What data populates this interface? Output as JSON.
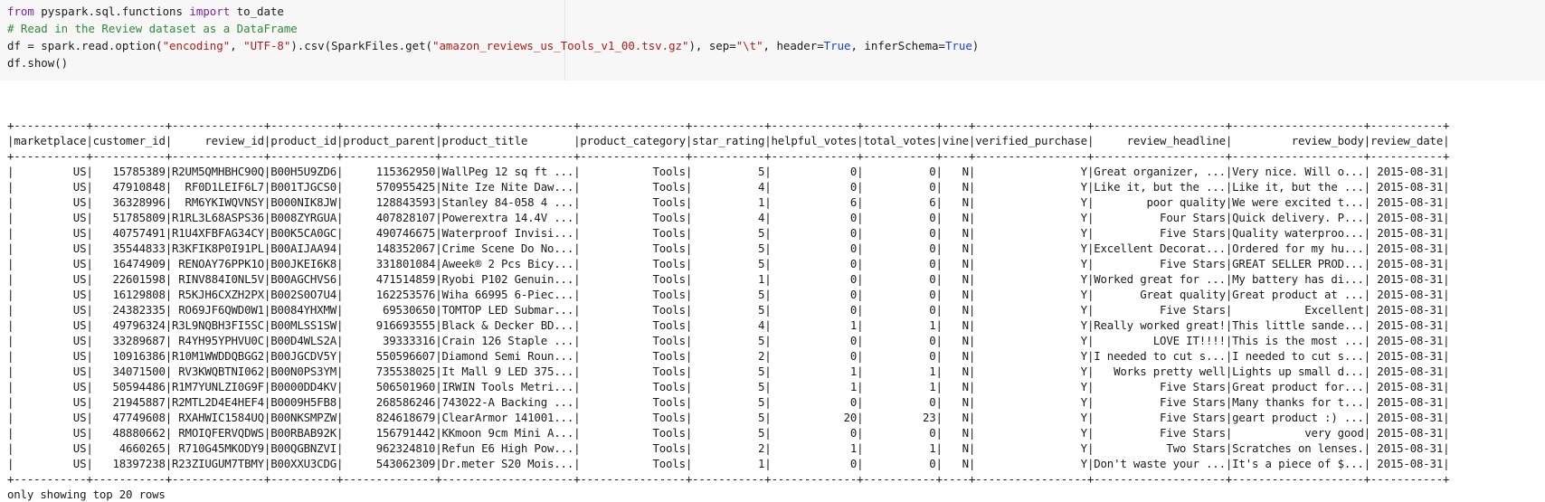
{
  "code_cell": {
    "line1": {
      "kw1": "from",
      "mod": " pyspark.sql.functions ",
      "kw2": "import",
      "rest": " to_date"
    },
    "line2": {
      "comment": "# Read in the Review dataset as a DataFrame"
    },
    "line3": {
      "a": "df = spark.read.option(",
      "s1": "\"encoding\"",
      "b": ", ",
      "s2": "\"UTF-8\"",
      "c": ").csv(SparkFiles.get(",
      "s3": "\"amazon_reviews_us_Tools_v1_00.tsv.gz\"",
      "d": "), sep=",
      "s4": "\"\\t\"",
      "e": ", header=",
      "t1": "True",
      "f": ", inferSchema=",
      "t2": "True",
      "g": ")"
    },
    "line4": {
      "text": "df.show()"
    }
  },
  "output": {
    "columns": [
      {
        "name": "marketplace",
        "width": 11,
        "align": "right"
      },
      {
        "name": "customer_id",
        "width": 11,
        "align": "right"
      },
      {
        "name": "review_id",
        "width": 14,
        "align": "right"
      },
      {
        "name": "product_id",
        "width": 10,
        "align": "right"
      },
      {
        "name": "product_parent",
        "width": 14,
        "align": "right"
      },
      {
        "name": "product_title",
        "width": 20,
        "align": "left"
      },
      {
        "name": "product_category",
        "width": 16,
        "align": "right"
      },
      {
        "name": "star_rating",
        "width": 11,
        "align": "right"
      },
      {
        "name": "helpful_votes",
        "width": 13,
        "align": "right"
      },
      {
        "name": "total_votes",
        "width": 11,
        "align": "right"
      },
      {
        "name": "vine",
        "width": 4,
        "align": "right"
      },
      {
        "name": "verified_purchase",
        "width": 17,
        "align": "right"
      },
      {
        "name": "review_headline",
        "width": 20,
        "align": "right"
      },
      {
        "name": "review_body",
        "width": 20,
        "align": "right"
      },
      {
        "name": "review_date",
        "width": 11,
        "align": "right"
      }
    ],
    "rows": [
      [
        "US",
        "15785389",
        "R2UM5QMHBHC90Q",
        "B00H5U9ZD6",
        "115362950",
        "WallPeg 12 sq ft ...",
        "Tools",
        "5",
        "0",
        "0",
        "N",
        "Y",
        "Great organizer, ...",
        "Very nice. Will o...",
        "2015-08-31"
      ],
      [
        "US",
        "47910848",
        "RF0D1LEIF6L7",
        "B001TJGCS0",
        "570955425",
        "Nite Ize Nite Daw...",
        "Tools",
        "4",
        "0",
        "0",
        "N",
        "Y",
        "Like it, but the ...",
        "Like it, but the ...",
        "2015-08-31"
      ],
      [
        "US",
        "36328996",
        "RM6YKIWQVNSY",
        "B000NIK8JW",
        "128843593",
        "Stanley 84-058 4 ...",
        "Tools",
        "1",
        "6",
        "6",
        "N",
        "Y",
        "poor quality",
        "We were excited t...",
        "2015-08-31"
      ],
      [
        "US",
        "51785809",
        "R1RL3L68ASPS36",
        "B008ZYRGUA",
        "407828107",
        "Powerextra 14.4V ...",
        "Tools",
        "4",
        "0",
        "0",
        "N",
        "Y",
        "Four Stars",
        "Quick delivery. P...",
        "2015-08-31"
      ],
      [
        "US",
        "40757491",
        "R1U4XFBFAG34CY",
        "B00K5CA0GC",
        "490746675",
        "Waterproof Invisi...",
        "Tools",
        "5",
        "0",
        "0",
        "N",
        "Y",
        "Five Stars",
        "Quality waterproo...",
        "2015-08-31"
      ],
      [
        "US",
        "35544833",
        "R3KFIK8P0I91PL",
        "B00AIJAA94",
        "148352067",
        "Crime Scene Do No...",
        "Tools",
        "5",
        "0",
        "0",
        "N",
        "Y",
        "Excellent Decorat...",
        "Ordered for my hu...",
        "2015-08-31"
      ],
      [
        "US",
        "16474909",
        "RENOAY76PPK1O",
        "B00JKEI6K8",
        "331801084",
        "Aweek® 2 Pcs Bicy...",
        "Tools",
        "5",
        "0",
        "0",
        "N",
        "Y",
        "Five Stars",
        "GREAT SELLER PROD...",
        "2015-08-31"
      ],
      [
        "US",
        "22601598",
        "RINV884I0NL5V",
        "B00AGCHVS6",
        "471514859",
        "Ryobi P102 Genuin...",
        "Tools",
        "1",
        "0",
        "0",
        "N",
        "Y",
        "Worked great for ...",
        "My battery has di...",
        "2015-08-31"
      ],
      [
        "US",
        "16129808",
        "R5KJH6CXZH2PX",
        "B002S0O7U4",
        "162253576",
        "Wiha 66995 6-Piec...",
        "Tools",
        "5",
        "0",
        "0",
        "N",
        "Y",
        "Great quality",
        "Great product at ...",
        "2015-08-31"
      ],
      [
        "US",
        "24382335",
        "RO69JF6QWD0W1",
        "B0084YHXMW",
        "69530650",
        "TOMTOP LED Submar...",
        "Tools",
        "5",
        "0",
        "0",
        "N",
        "Y",
        "Five Stars",
        "Excellent",
        "2015-08-31"
      ],
      [
        "US",
        "49796324",
        "R3L9NQBH3FI5SC",
        "B00MLSS1SW",
        "916693555",
        "Black & Decker BD...",
        "Tools",
        "4",
        "1",
        "1",
        "N",
        "Y",
        "Really worked great!",
        "This little sande...",
        "2015-08-31"
      ],
      [
        "US",
        "33289687",
        "R4YH95YPHVU0C",
        "B00D4WLS2A",
        "39333316",
        "Crain 126 Staple ...",
        "Tools",
        "5",
        "0",
        "0",
        "N",
        "Y",
        "LOVE IT!!!!",
        "This is the most ...",
        "2015-08-31"
      ],
      [
        "US",
        "10916386",
        "R10M1WWDDQBGG2",
        "B00JGCDV5Y",
        "550596607",
        "Diamond Semi Roun...",
        "Tools",
        "2",
        "0",
        "0",
        "N",
        "Y",
        "I needed to cut s...",
        "I needed to cut s...",
        "2015-08-31"
      ],
      [
        "US",
        "34071500",
        "RV3KWQBTNI062",
        "B00N0PS3YM",
        "735538025",
        "It Mall 9 LED 375...",
        "Tools",
        "5",
        "1",
        "1",
        "N",
        "Y",
        "Works pretty well",
        "Lights up small d...",
        "2015-08-31"
      ],
      [
        "US",
        "50594486",
        "R1M7YUNLZI0G9F",
        "B0000DD4KV",
        "506501960",
        "IRWIN Tools Metri...",
        "Tools",
        "5",
        "1",
        "1",
        "N",
        "Y",
        "Five Stars",
        "Great product for...",
        "2015-08-31"
      ],
      [
        "US",
        "21945887",
        "R2MTL2D4E4HEF4",
        "B0009H5FB8",
        "268586246",
        "743022-A Backing ...",
        "Tools",
        "5",
        "0",
        "0",
        "N",
        "Y",
        "Five Stars",
        "Many thanks for t...",
        "2015-08-31"
      ],
      [
        "US",
        "47749608",
        "RXAHWIC1584UQ",
        "B00NKSMPZW",
        "824618679",
        "ClearArmor 141001...",
        "Tools",
        "5",
        "20",
        "23",
        "N",
        "Y",
        "Five Stars",
        "geart product :) ...",
        "2015-08-31"
      ],
      [
        "US",
        "48880662",
        "RMOIQFERVQDWS",
        "B00RBAB92K",
        "156791442",
        "KKmoon 9cm Mini A...",
        "Tools",
        "5",
        "0",
        "0",
        "N",
        "Y",
        "Five Stars",
        "very good",
        "2015-08-31"
      ],
      [
        "US",
        "4660265",
        "R710G45MKODY9",
        "B00QGBNZVI",
        "962324810",
        "Refun E6 High Pow...",
        "Tools",
        "2",
        "1",
        "1",
        "N",
        "Y",
        "Two Stars",
        "Scratches on lenses.",
        "2015-08-31"
      ],
      [
        "US",
        "18397238",
        "R23ZIUGUM7TBMY",
        "B00XXU3CDG",
        "543062309",
        "Dr.meter S20 Mois...",
        "Tools",
        "1",
        "0",
        "0",
        "N",
        "Y",
        "Don't waste your ...",
        "It's a piece of $...",
        "2015-08-31"
      ]
    ],
    "footer": "only showing top 20 rows"
  }
}
